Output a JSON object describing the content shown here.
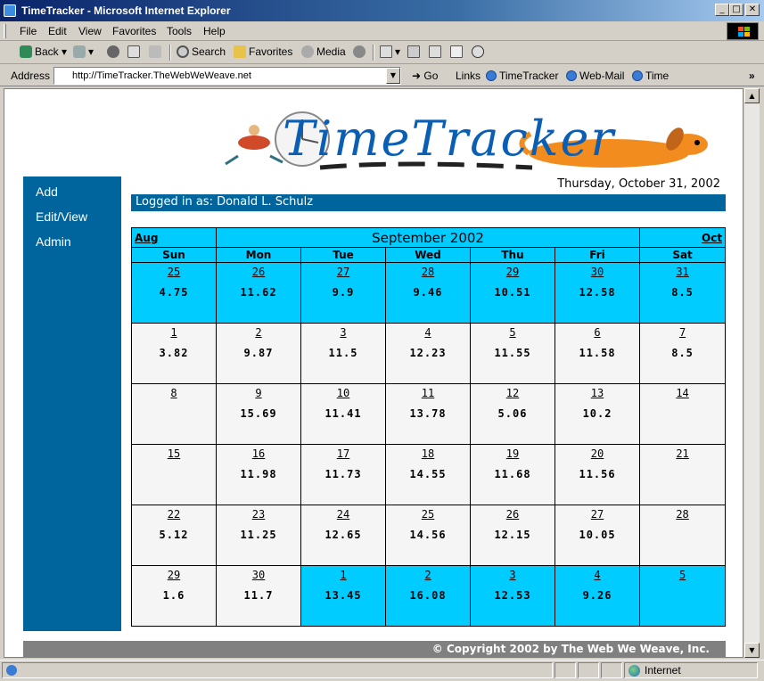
{
  "window": {
    "title": "TimeTracker - Microsoft Internet Explorer",
    "minimize_label": "_",
    "maximize_label": "□",
    "close_label": "✕"
  },
  "menu": [
    "File",
    "Edit",
    "View",
    "Favorites",
    "Tools",
    "Help"
  ],
  "toolbar": {
    "back": "Back",
    "search": "Search",
    "favorites": "Favorites",
    "media": "Media"
  },
  "address": {
    "label": "Address",
    "url": "http://TimeTracker.TheWebWeWeave.net",
    "go": "Go",
    "links_label": "Links",
    "links": [
      "TimeTracker",
      "Web-Mail",
      "Time"
    ]
  },
  "page": {
    "logo_text": "TimeTracker",
    "date": "Thursday, October 31, 2002",
    "logged_in": "Logged in as: Donald L. Schulz",
    "nav": [
      "Add",
      "Edit/View",
      "Admin"
    ],
    "footer": "© Copyright 2002 by The Web We Weave, Inc."
  },
  "calendar": {
    "title": "September 2002",
    "prev": "Aug",
    "next": "Oct",
    "weekdays": [
      "Sun",
      "Mon",
      "Tue",
      "Wed",
      "Thu",
      "Fri",
      "Sat"
    ],
    "weeks": [
      [
        {
          "d": "25",
          "h": "4.75",
          "o": true
        },
        {
          "d": "26",
          "h": "11.62",
          "o": true
        },
        {
          "d": "27",
          "h": "9.9",
          "o": true
        },
        {
          "d": "28",
          "h": "9.46",
          "o": true
        },
        {
          "d": "29",
          "h": "10.51",
          "o": true
        },
        {
          "d": "30",
          "h": "12.58",
          "o": true
        },
        {
          "d": "31",
          "h": "8.5",
          "o": true
        }
      ],
      [
        {
          "d": "1",
          "h": "3.82"
        },
        {
          "d": "2",
          "h": "9.87"
        },
        {
          "d": "3",
          "h": "11.5"
        },
        {
          "d": "4",
          "h": "12.23"
        },
        {
          "d": "5",
          "h": "11.55"
        },
        {
          "d": "6",
          "h": "11.58"
        },
        {
          "d": "7",
          "h": "8.5"
        }
      ],
      [
        {
          "d": "8",
          "h": ""
        },
        {
          "d": "9",
          "h": "15.69"
        },
        {
          "d": "10",
          "h": "11.41"
        },
        {
          "d": "11",
          "h": "13.78"
        },
        {
          "d": "12",
          "h": "5.06"
        },
        {
          "d": "13",
          "h": "10.2"
        },
        {
          "d": "14",
          "h": ""
        }
      ],
      [
        {
          "d": "15",
          "h": ""
        },
        {
          "d": "16",
          "h": "11.98"
        },
        {
          "d": "17",
          "h": "11.73"
        },
        {
          "d": "18",
          "h": "14.55"
        },
        {
          "d": "19",
          "h": "11.68"
        },
        {
          "d": "20",
          "h": "11.56"
        },
        {
          "d": "21",
          "h": ""
        }
      ],
      [
        {
          "d": "22",
          "h": "5.12"
        },
        {
          "d": "23",
          "h": "11.25"
        },
        {
          "d": "24",
          "h": "12.65"
        },
        {
          "d": "25",
          "h": "14.56"
        },
        {
          "d": "26",
          "h": "12.15"
        },
        {
          "d": "27",
          "h": "10.05"
        },
        {
          "d": "28",
          "h": ""
        }
      ],
      [
        {
          "d": "29",
          "h": "1.6"
        },
        {
          "d": "30",
          "h": "11.7"
        },
        {
          "d": "1",
          "h": "13.45",
          "o": true
        },
        {
          "d": "2",
          "h": "16.08",
          "o": true
        },
        {
          "d": "3",
          "h": "12.53",
          "o": true
        },
        {
          "d": "4",
          "h": "9.26",
          "o": true
        },
        {
          "d": "5",
          "h": "",
          "o": true
        }
      ]
    ]
  },
  "status": {
    "zone": "Internet"
  },
  "colors": {
    "nav_bg": "#00659c",
    "cal_highlight": "#00ccff",
    "cal_normal": "#f5f5f5",
    "footer_bg": "#808080"
  }
}
